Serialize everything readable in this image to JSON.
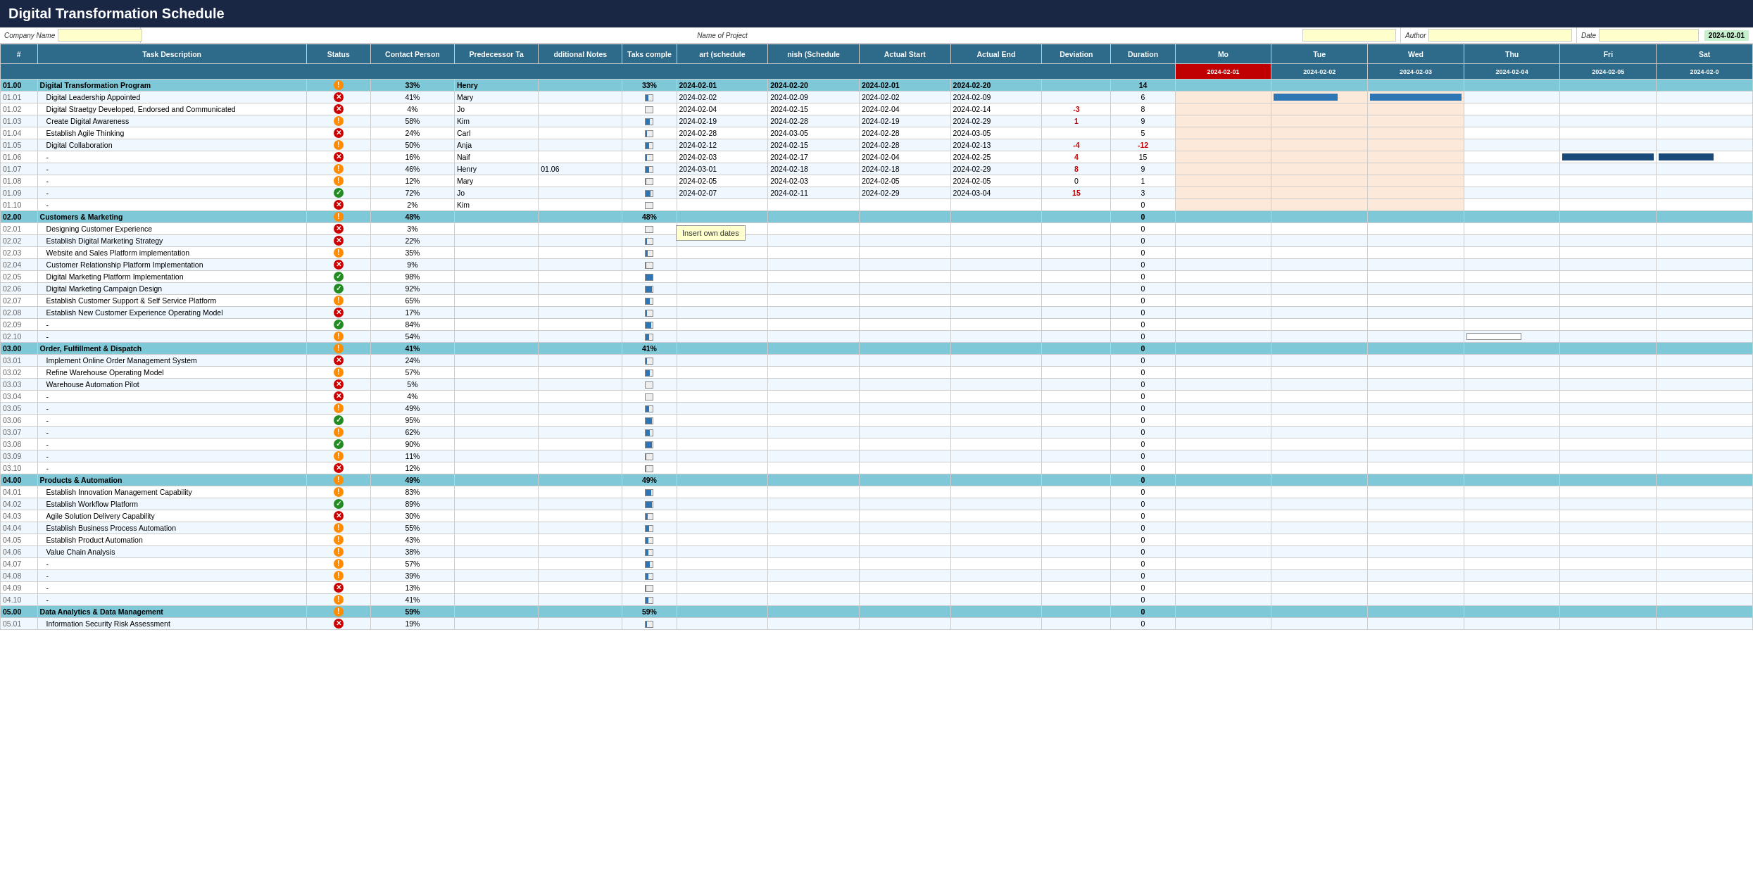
{
  "title": "Digital Transformation Schedule",
  "form": {
    "company_label": "Company Name",
    "project_label": "Name of Project",
    "author_label": "Author",
    "date_label": "Date",
    "date_value": "2024-02-01"
  },
  "headers": {
    "num": "#",
    "task": "Task Description",
    "status": "Status",
    "contact": "Contact Person",
    "pred": "Predecessor Ta",
    "notes": "dditional Notes",
    "pct_complete": "Taks comple",
    "sched_start": "art (schedule",
    "sched_end": "nish (Schedule",
    "actual_start": "Actual Start",
    "actual_end": "Actual End",
    "deviation": "Deviation",
    "duration": "Duration"
  },
  "gantt_dates": {
    "mo": "Mo",
    "tue": "Tue",
    "wed": "Wed",
    "thu": "Thu",
    "fri": "Fri",
    "sat": "Sat",
    "dates": [
      "2024-02-01",
      "2024-02-02",
      "2024-02-03",
      "2024-02-04",
      "2024-02-05",
      "2024-02-0"
    ]
  },
  "tooltip": "Insert own dates",
  "sections": [
    {
      "id": "01.00",
      "name": "Digital Transformation Program",
      "is_section": true,
      "status": "orange",
      "pct": "33%",
      "contact": "Henry",
      "pred": "",
      "notes": "...",
      "pct_complete": "33%",
      "sched_start": "2024-02-01",
      "sched_end": "2024-02-20",
      "actual_start": "2024-02-01",
      "actual_end": "2024-02-20",
      "deviation": "",
      "duration": "14",
      "tasks": [
        {
          "id": "01.01",
          "name": "Digital Leadership Appointed",
          "status": "red",
          "pct": "41%",
          "contact": "Mary",
          "pred": "",
          "notes": "...",
          "sched_start": "2024-02-02",
          "sched_end": "2024-02-09",
          "actual_start": "2024-02-02",
          "actual_end": "2024-02-09",
          "deviation": "",
          "duration": "6",
          "has_bar": true
        },
        {
          "id": "01.02",
          "name": "Digital Straetgy Developed, Endorsed and Communicated",
          "status": "red",
          "pct": "4%",
          "contact": "Jo",
          "pred": "",
          "notes": "...",
          "sched_start": "2024-02-04",
          "sched_end": "2024-02-15",
          "actual_start": "2024-02-04",
          "actual_end": "2024-02-14",
          "deviation": "-3",
          "duration": "8",
          "has_bar": false
        },
        {
          "id": "01.03",
          "name": "Create Digital Awareness",
          "status": "orange",
          "pct": "58%",
          "contact": "Kim",
          "pred": "",
          "notes": "...",
          "sched_start": "2024-02-19",
          "sched_end": "2024-02-28",
          "actual_start": "2024-02-19",
          "actual_end": "2024-02-29",
          "deviation": "1",
          "duration": "9",
          "has_bar": false
        },
        {
          "id": "01.04",
          "name": "Establish Agile Thinking",
          "status": "red",
          "pct": "24%",
          "contact": "Carl",
          "pred": "",
          "notes": "...",
          "sched_start": "2024-02-28",
          "sched_end": "2024-03-05",
          "actual_start": "2024-02-28",
          "actual_end": "2024-03-05",
          "deviation": "",
          "duration": "5",
          "has_bar": false
        },
        {
          "id": "01.05",
          "name": "Digital Collaboration",
          "status": "orange",
          "pct": "50%",
          "contact": "Anja",
          "pred": "",
          "notes": "...",
          "sched_start": "2024-02-12",
          "sched_end": "2024-02-15",
          "actual_start": "2024-02-28",
          "actual_end": "2024-02-13",
          "deviation": "-4",
          "duration": "-12",
          "has_bar": false
        },
        {
          "id": "01.06",
          "name": "-",
          "status": "red",
          "pct": "16%",
          "contact": "Naif",
          "pred": "",
          "notes": "...",
          "sched_start": "2024-02-03",
          "sched_end": "2024-02-17",
          "actual_start": "2024-02-04",
          "actual_end": "2024-02-25",
          "deviation": "4",
          "duration": "15",
          "has_bar": true
        },
        {
          "id": "01.07",
          "name": "-",
          "status": "orange",
          "pct": "46%",
          "contact": "Henry",
          "pred": "01.06",
          "notes": "...",
          "sched_start": "2024-03-01",
          "sched_end": "2024-02-18",
          "actual_start": "2024-02-18",
          "actual_end": "2024-02-29",
          "deviation": "8",
          "duration": "9",
          "has_bar": false
        },
        {
          "id": "01.08",
          "name": "-",
          "status": "orange",
          "pct": "12%",
          "contact": "Mary",
          "pred": "",
          "notes": "...",
          "sched_start": "2024-02-05",
          "sched_end": "2024-02-03",
          "actual_start": "2024-02-05",
          "actual_end": "2024-02-05",
          "deviation": "0",
          "duration": "1",
          "has_bar": false
        },
        {
          "id": "01.09",
          "name": "-",
          "status": "green",
          "pct": "72%",
          "contact": "Jo",
          "pred": "",
          "notes": "...",
          "sched_start": "2024-02-07",
          "sched_end": "2024-02-11",
          "actual_start": "2024-02-29",
          "actual_end": "2024-03-04",
          "deviation": "15",
          "duration": "3",
          "has_bar": false
        },
        {
          "id": "01.10",
          "name": "-",
          "status": "red",
          "pct": "2%",
          "contact": "Kim",
          "pred": "",
          "notes": "...",
          "sched_start": "",
          "sched_end": "",
          "actual_start": "",
          "actual_end": "",
          "deviation": "",
          "duration": "0",
          "has_bar": false
        }
      ]
    },
    {
      "id": "02.00",
      "name": "Customers & Marketing",
      "is_section": true,
      "status": "orange",
      "pct": "48%",
      "contact": "",
      "pred": "",
      "notes": "",
      "pct_complete": "48%",
      "sched_start": "",
      "sched_end": "",
      "actual_start": "",
      "actual_end": "",
      "deviation": "",
      "duration": "0",
      "tasks": [
        {
          "id": "02.01",
          "name": "Designing Customer Experience",
          "status": "red",
          "pct": "3%",
          "contact": "",
          "pred": "",
          "notes": "",
          "sched_start": "",
          "sched_end": "",
          "actual_start": "",
          "actual_end": "",
          "deviation": "",
          "duration": "0",
          "has_bar": false
        },
        {
          "id": "02.02",
          "name": "Establish Digital Marketing Strategy",
          "status": "red",
          "pct": "22%",
          "contact": "",
          "pred": "",
          "notes": "",
          "sched_start": "",
          "sched_end": "",
          "actual_start": "",
          "actual_end": "",
          "deviation": "",
          "duration": "0",
          "has_bar": false
        },
        {
          "id": "02.03",
          "name": "Website and Sales Platform implementation",
          "status": "orange",
          "pct": "35%",
          "contact": "",
          "pred": "",
          "notes": "",
          "sched_start": "",
          "sched_end": "",
          "actual_start": "",
          "actual_end": "",
          "deviation": "",
          "duration": "0",
          "has_bar": false
        },
        {
          "id": "02.04",
          "name": "Customer Relationship Platform Implementation",
          "status": "red",
          "pct": "9%",
          "contact": "",
          "pred": "",
          "notes": "",
          "sched_start": "",
          "sched_end": "",
          "actual_start": "",
          "actual_end": "",
          "deviation": "",
          "duration": "0",
          "has_bar": false
        },
        {
          "id": "02.05",
          "name": "Digital Marketing Platform Implementation",
          "status": "green",
          "pct": "98%",
          "contact": "",
          "pred": "",
          "notes": "",
          "sched_start": "",
          "sched_end": "",
          "actual_start": "",
          "actual_end": "",
          "deviation": "",
          "duration": "0",
          "has_bar": false
        },
        {
          "id": "02.06",
          "name": "Digital Marketing Campaign Design",
          "status": "green",
          "pct": "92%",
          "contact": "",
          "pred": "",
          "notes": "",
          "sched_start": "",
          "sched_end": "",
          "actual_start": "",
          "actual_end": "",
          "deviation": "",
          "duration": "0",
          "has_bar": false
        },
        {
          "id": "02.07",
          "name": "Establish Customer Support & Self Service Platform",
          "status": "orange",
          "pct": "65%",
          "contact": "",
          "pred": "",
          "notes": "",
          "sched_start": "",
          "sched_end": "",
          "actual_start": "",
          "actual_end": "",
          "deviation": "",
          "duration": "0",
          "has_bar": false
        },
        {
          "id": "02.08",
          "name": "Establish New Customer Experience Operating Model",
          "status": "red",
          "pct": "17%",
          "contact": "",
          "pred": "",
          "notes": "",
          "sched_start": "",
          "sched_end": "",
          "actual_start": "",
          "actual_end": "",
          "deviation": "",
          "duration": "0",
          "has_bar": false
        },
        {
          "id": "02.09",
          "name": "-",
          "status": "green",
          "pct": "84%",
          "contact": "",
          "pred": "",
          "notes": "",
          "sched_start": "",
          "sched_end": "",
          "actual_start": "",
          "actual_end": "",
          "deviation": "",
          "duration": "0",
          "has_bar": false
        },
        {
          "id": "02.10",
          "name": "-",
          "status": "orange",
          "pct": "54%",
          "contact": "",
          "pred": "",
          "notes": "",
          "sched_start": "",
          "sched_end": "",
          "actual_start": "",
          "actual_end": "",
          "deviation": "",
          "duration": "0",
          "has_bar": true,
          "bar_empty": true
        }
      ]
    },
    {
      "id": "03.00",
      "name": "Order, Fulfillment & Dispatch",
      "is_section": true,
      "status": "orange",
      "pct": "41%",
      "pct_complete": "41%",
      "deviation": "",
      "duration": "0",
      "tasks": [
        {
          "id": "03.01",
          "name": "Implement Online Order Management System",
          "status": "red",
          "pct": "24%",
          "deviation": "",
          "duration": "0"
        },
        {
          "id": "03.02",
          "name": "Refine Warehouse Operating Model",
          "status": "orange",
          "pct": "57%",
          "deviation": "",
          "duration": "0"
        },
        {
          "id": "03.03",
          "name": "Warehouse Automation Pilot",
          "status": "red",
          "pct": "5%",
          "deviation": "",
          "duration": "0"
        },
        {
          "id": "03.04",
          "name": "-",
          "status": "red",
          "pct": "4%",
          "deviation": "",
          "duration": "0"
        },
        {
          "id": "03.05",
          "name": "-",
          "status": "orange",
          "pct": "49%",
          "deviation": "",
          "duration": "0"
        },
        {
          "id": "03.06",
          "name": "-",
          "status": "green",
          "pct": "95%",
          "deviation": "",
          "duration": "0"
        },
        {
          "id": "03.07",
          "name": "-",
          "status": "orange",
          "pct": "62%",
          "deviation": "",
          "duration": "0"
        },
        {
          "id": "03.08",
          "name": "-",
          "status": "green",
          "pct": "90%",
          "deviation": "",
          "duration": "0"
        },
        {
          "id": "03.09",
          "name": "-",
          "status": "orange",
          "pct": "11%",
          "deviation": "",
          "duration": "0"
        },
        {
          "id": "03.10",
          "name": "-",
          "status": "red",
          "pct": "12%",
          "deviation": "",
          "duration": "0"
        }
      ]
    },
    {
      "id": "04.00",
      "name": "Products & Automation",
      "is_section": true,
      "status": "orange",
      "pct": "49%",
      "pct_complete": "49%",
      "deviation": "",
      "duration": "0",
      "tasks": [
        {
          "id": "04.01",
          "name": "Establish Innovation Management Capability",
          "status": "orange",
          "pct": "83%",
          "deviation": "",
          "duration": "0"
        },
        {
          "id": "04.02",
          "name": "Establish Workflow Platform",
          "status": "green",
          "pct": "89%",
          "deviation": "",
          "duration": "0"
        },
        {
          "id": "04.03",
          "name": "Agile Solution Delivery Capability",
          "status": "red",
          "pct": "30%",
          "deviation": "",
          "duration": "0"
        },
        {
          "id": "04.04",
          "name": "Establish Business Process Automation",
          "status": "orange",
          "pct": "55%",
          "deviation": "",
          "duration": "0"
        },
        {
          "id": "04.05",
          "name": "Establish Product Automation",
          "status": "orange",
          "pct": "43%",
          "deviation": "",
          "duration": "0"
        },
        {
          "id": "04.06",
          "name": "Value Chain Analysis",
          "status": "orange",
          "pct": "38%",
          "deviation": "",
          "duration": "0"
        },
        {
          "id": "04.07",
          "name": "-",
          "status": "orange",
          "pct": "57%",
          "deviation": "",
          "duration": "0"
        },
        {
          "id": "04.08",
          "name": "-",
          "status": "orange",
          "pct": "39%",
          "deviation": "",
          "duration": "0"
        },
        {
          "id": "04.09",
          "name": "-",
          "status": "red",
          "pct": "13%",
          "deviation": "",
          "duration": "0"
        },
        {
          "id": "04.10",
          "name": "-",
          "status": "orange",
          "pct": "41%",
          "deviation": "",
          "duration": "0"
        }
      ]
    },
    {
      "id": "05.00",
      "name": "Data Analytics & Data Management",
      "is_section": true,
      "status": "orange",
      "pct": "59%",
      "pct_complete": "59%",
      "deviation": "",
      "duration": "0",
      "tasks": [
        {
          "id": "05.01",
          "name": "Information Security Risk Assessment",
          "status": "red",
          "pct": "19%",
          "deviation": "",
          "duration": "0"
        }
      ]
    }
  ]
}
